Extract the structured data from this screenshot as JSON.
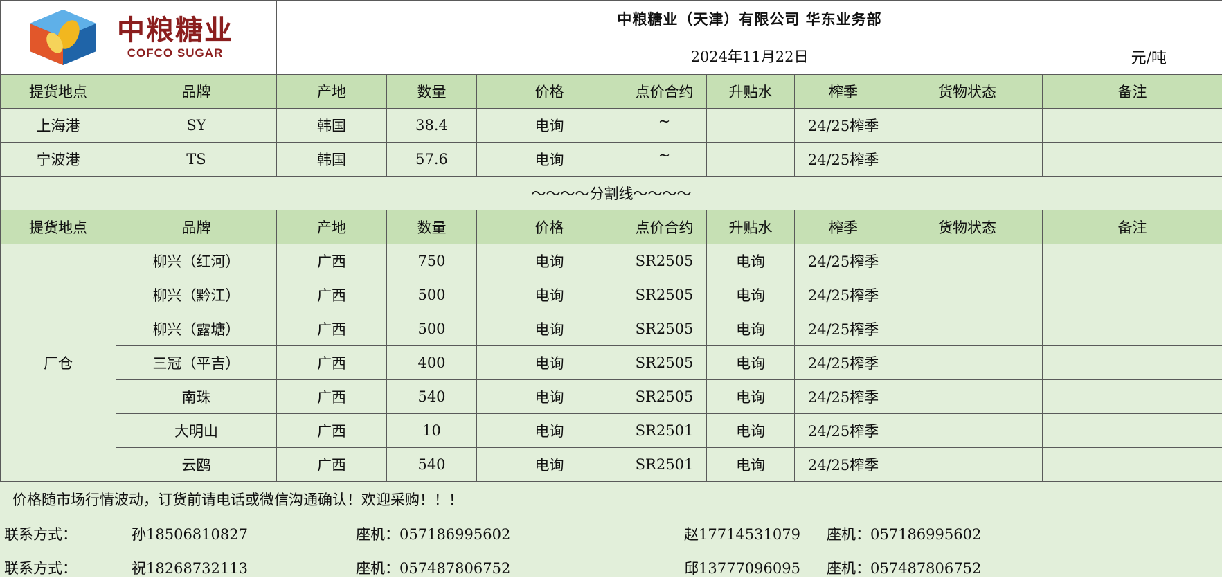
{
  "brand": {
    "name_cn": "中粮糖业",
    "name_en": "COFCO SUGAR",
    "colors": {
      "red": "#8b1e1e",
      "blue": "#2c7fc1",
      "yellow": "#f2b71f",
      "orange": "#e2572a"
    }
  },
  "header": {
    "title": "中粮糖业（天津）有限公司 华东业务部",
    "date": "2024年11月22日",
    "unit": "元/吨"
  },
  "columns": [
    "提货地点",
    "品牌",
    "产地",
    "数量",
    "价格",
    "点价合约",
    "升贴水",
    "榨季",
    "货物状态",
    "备注"
  ],
  "section1": [
    [
      "上海港",
      "SY",
      "韩国",
      "38.4",
      "电询",
      "~",
      "",
      "24/25榨季",
      "",
      ""
    ],
    [
      "宁波港",
      "TS",
      "韩国",
      "57.6",
      "电询",
      "~",
      "",
      "24/25榨季",
      "",
      ""
    ]
  ],
  "separator": "～～～～分割线～～～～",
  "section2": {
    "location": "厂仓",
    "rows": [
      [
        "柳兴（红河）",
        "广西",
        "750",
        "电询",
        "SR2505",
        "电询",
        "24/25榨季",
        "",
        ""
      ],
      [
        "柳兴（黔江）",
        "广西",
        "500",
        "电询",
        "SR2505",
        "电询",
        "24/25榨季",
        "",
        ""
      ],
      [
        "柳兴（露塘）",
        "广西",
        "500",
        "电询",
        "SR2505",
        "电询",
        "24/25榨季",
        "",
        ""
      ],
      [
        "三冠（平吉）",
        "广西",
        "400",
        "电询",
        "SR2505",
        "电询",
        "24/25榨季",
        "",
        ""
      ],
      [
        "南珠",
        "广西",
        "540",
        "电询",
        "SR2505",
        "电询",
        "24/25榨季",
        "",
        ""
      ],
      [
        "大明山",
        "广西",
        "10",
        "电询",
        "SR2501",
        "电询",
        "24/25榨季",
        "",
        ""
      ],
      [
        "云鸥",
        "广西",
        "540",
        "电询",
        "SR2501",
        "电询",
        "24/25榨季",
        "",
        ""
      ]
    ]
  },
  "footer": {
    "note": "价格随市场行情波动，订货前请电话或微信沟通确认！欢迎采购！！！",
    "contacts": [
      {
        "label": "联系方式：",
        "person1": "孙18506810827",
        "landline1": "座机：057186995602",
        "person2": "赵17714531079",
        "landline2": "座机：057186995602"
      },
      {
        "label": "联系方式：",
        "person1": "祝18268732113",
        "landline1": "座机：057487806752",
        "person2": "邱13777096095",
        "landline2": "座机：057487806752"
      }
    ]
  }
}
